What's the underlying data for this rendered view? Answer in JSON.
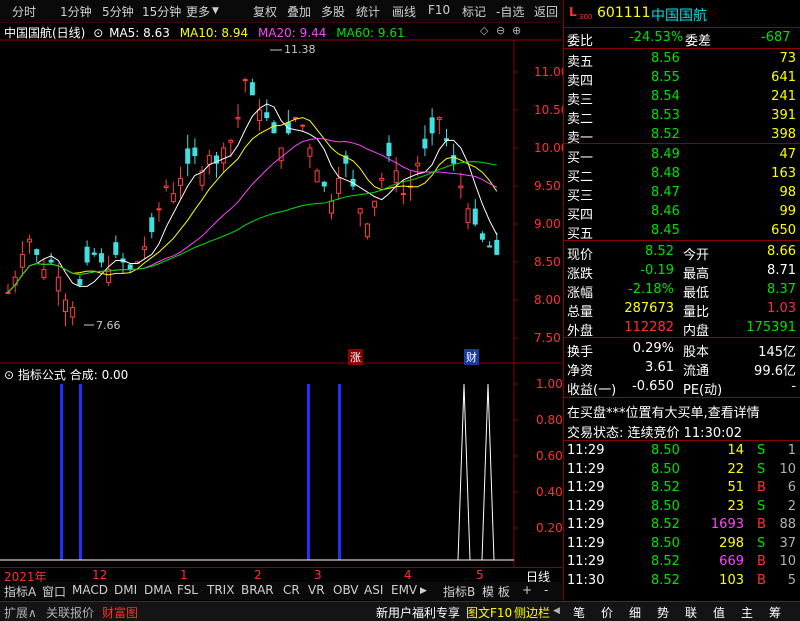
{
  "toolbar": {
    "left_items": [
      "分时",
      "1分钟",
      "5分钟",
      "15分钟",
      "更多"
    ],
    "right_items": [
      "复权",
      "叠加",
      "多股",
      "统计",
      "画线",
      "F10",
      "标记",
      "-自选",
      "返回"
    ]
  },
  "chart_header": {
    "name": "中国国航(日线)",
    "ma5": "MA5: 8.63",
    "ma10": "MA10: 8.94",
    "ma20": "MA20: 9.44",
    "ma60": "MA60: 9.61"
  },
  "price_axis": {
    "ticks": [
      "11.00",
      "10.50",
      "10.00",
      "9.50",
      "9.00",
      "8.50",
      "8.00",
      "7.50"
    ],
    "high_label": "11.38",
    "low_label": "7.66"
  },
  "markers": {
    "zhang": "涨",
    "cai": "财"
  },
  "indicator": {
    "title": "指标公式 合成: 0.00",
    "ticks": [
      "1.00",
      "0.80",
      "0.60",
      "0.40",
      "0.20"
    ]
  },
  "date_axis": {
    "labels": [
      "2021年",
      "12",
      "1",
      "2",
      "3",
      "4",
      "5"
    ],
    "period": "日线"
  },
  "bottom_tabs": [
    "指标A",
    "窗口",
    "MACD",
    "DMI",
    "DMA",
    "FSL",
    "TRIX",
    "BRAR",
    "CR",
    "VR",
    "OBV",
    "ASI",
    "EMV",
    "指标B",
    "模 板",
    "+",
    "-"
  ],
  "status_bar": {
    "left": [
      "扩展∧",
      "关联报价",
      "财富图"
    ],
    "middle": [
      "新用户福利专享",
      "图文F10",
      "侧边栏"
    ],
    "right_icons": [
      "笔",
      "价",
      "细",
      "势",
      "联",
      "值",
      "主",
      "筹"
    ]
  },
  "quote": {
    "code": "601111",
    "name": "中国国航",
    "weibi_label": "委比",
    "weibi": "-24.53%",
    "weicha_label": "委差",
    "weicha": "-687",
    "asks": [
      {
        "label": "卖五",
        "price": "8.56",
        "vol": "73"
      },
      {
        "label": "卖四",
        "price": "8.55",
        "vol": "641"
      },
      {
        "label": "卖三",
        "price": "8.54",
        "vol": "241"
      },
      {
        "label": "卖二",
        "price": "8.53",
        "vol": "391"
      },
      {
        "label": "卖一",
        "price": "8.52",
        "vol": "398"
      }
    ],
    "bids": [
      {
        "label": "买一",
        "price": "8.49",
        "vol": "47"
      },
      {
        "label": "买二",
        "price": "8.48",
        "vol": "163"
      },
      {
        "label": "买三",
        "price": "8.47",
        "vol": "98"
      },
      {
        "label": "买四",
        "price": "8.46",
        "vol": "99"
      },
      {
        "label": "买五",
        "price": "8.45",
        "vol": "650"
      }
    ],
    "stats": [
      {
        "l1": "现价",
        "v1": "8.52",
        "l2": "今开",
        "v2": "8.66"
      },
      {
        "l1": "涨跌",
        "v1": "-0.19",
        "l2": "最高",
        "v2": "8.71"
      },
      {
        "l1": "涨幅",
        "v1": "-2.18%",
        "l2": "最低",
        "v2": "8.37"
      },
      {
        "l1": "总量",
        "v1": "287673",
        "l2": "量比",
        "v2": "1.03"
      },
      {
        "l1": "外盘",
        "v1": "112282",
        "l2": "内盘",
        "v2": "175391"
      }
    ],
    "stats2": [
      {
        "l1": "换手",
        "v1": "0.29%",
        "l2": "股本",
        "v2": "145亿"
      },
      {
        "l1": "净资",
        "v1": "3.61",
        "l2": "流通",
        "v2": "99.6亿"
      },
      {
        "l1": "收益(一)",
        "v1": "-0.650",
        "l2": "PE(动)",
        "v2": "-"
      }
    ],
    "notice": "在买盘***位置有大买单,查看详情",
    "trade_status": "交易状态: 连续竞价 11:30:02",
    "ticks": [
      {
        "time": "11:29",
        "price": "8.50",
        "vol": "14",
        "side": "S",
        "n": "1"
      },
      {
        "time": "11:29",
        "price": "8.50",
        "vol": "22",
        "side": "S",
        "n": "10"
      },
      {
        "time": "11:29",
        "price": "8.52",
        "vol": "51",
        "side": "B",
        "n": "6"
      },
      {
        "time": "11:29",
        "price": "8.50",
        "vol": "23",
        "side": "S",
        "n": "2"
      },
      {
        "time": "11:29",
        "price": "8.52",
        "vol": "1693",
        "side": "B",
        "n": "88"
      },
      {
        "time": "11:29",
        "price": "8.50",
        "vol": "298",
        "side": "S",
        "n": "37"
      },
      {
        "time": "11:29",
        "price": "8.52",
        "vol": "669",
        "side": "B",
        "n": "10"
      },
      {
        "time": "11:30",
        "price": "8.52",
        "vol": "103",
        "side": "B",
        "n": "5"
      }
    ]
  }
}
